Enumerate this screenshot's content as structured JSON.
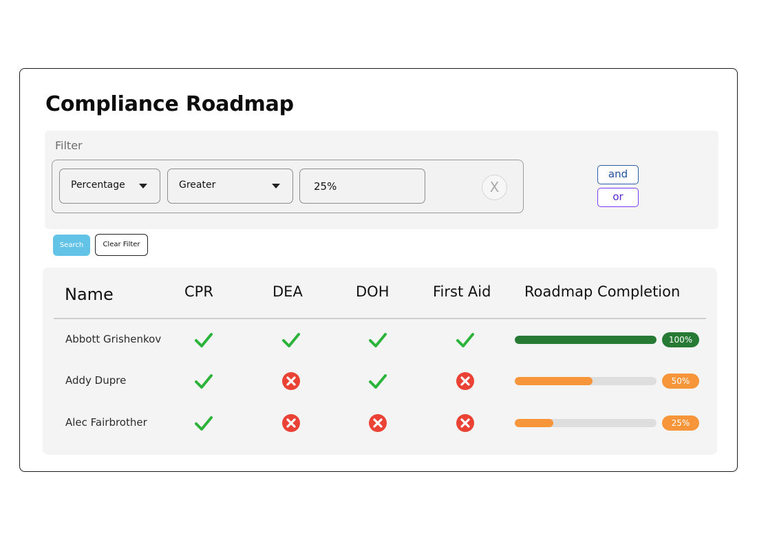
{
  "page": {
    "title": "Compliance Roadmap"
  },
  "filter": {
    "label": "Filter",
    "field_select": {
      "value": "Percentage"
    },
    "operator_select": {
      "value": "Greater"
    },
    "value_input": {
      "value": "25%"
    },
    "clear_glyph": "X",
    "logic": {
      "and_label": "and",
      "or_label": "or"
    },
    "search_label": "Search",
    "clear_filter_label": "Clear Filter"
  },
  "table": {
    "columns": [
      "Name",
      "CPR",
      "DEA",
      "DOH",
      "First Aid",
      "Roadmap Completion"
    ],
    "rows": [
      {
        "name": "Abbott Grishenkov",
        "cpr": "check",
        "dea": "check",
        "doh": "check",
        "first_aid": "check",
        "completion": 1.0,
        "completion_label": "100%",
        "bar_color": "#267a34"
      },
      {
        "name": "Addy Dupre",
        "cpr": "check",
        "dea": "cross",
        "doh": "check",
        "first_aid": "cross",
        "completion": 0.55,
        "completion_label": "50%",
        "bar_color": "#f7953a"
      },
      {
        "name": "Alec Fairbrother",
        "cpr": "check",
        "dea": "cross",
        "doh": "cross",
        "first_aid": "cross",
        "completion": 0.27,
        "completion_label": "25%",
        "bar_color": "#f7953a"
      }
    ]
  },
  "colors": {
    "check": "#2bb33a",
    "cross": "#ea4335",
    "complete_badge": "#267a34",
    "partial_badge": "#f7953a"
  },
  "icons": {
    "complete": "check-icon",
    "incomplete": "x-circle-icon",
    "dropdown": "caret-down-icon"
  }
}
